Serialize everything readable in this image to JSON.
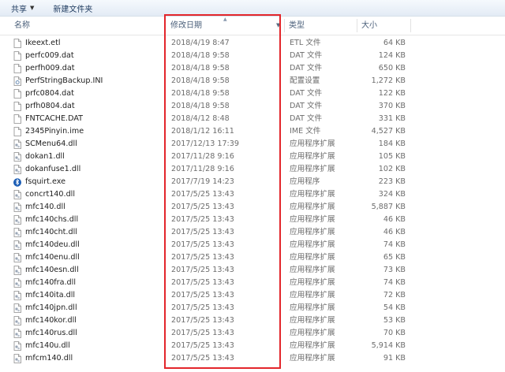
{
  "toolbar": {
    "share_label": "共享",
    "new_folder_label": "新建文件夹"
  },
  "columns": {
    "name": "名称",
    "date": "修改日期",
    "type": "类型",
    "size": "大小"
  },
  "files": [
    {
      "name": "Ikeext.etl",
      "date": "2018/4/19 8:47",
      "type": "ETL 文件",
      "size": "64 KB",
      "icon": "file-icon"
    },
    {
      "name": "perfc009.dat",
      "date": "2018/4/18 9:58",
      "type": "DAT 文件",
      "size": "124 KB",
      "icon": "file-icon"
    },
    {
      "name": "perfh009.dat",
      "date": "2018/4/18 9:58",
      "type": "DAT 文件",
      "size": "650 KB",
      "icon": "file-icon"
    },
    {
      "name": "PerfStringBackup.INI",
      "date": "2018/4/18 9:58",
      "type": "配置设置",
      "size": "1,272 KB",
      "icon": "settings-file-icon"
    },
    {
      "name": "prfc0804.dat",
      "date": "2018/4/18 9:58",
      "type": "DAT 文件",
      "size": "122 KB",
      "icon": "file-icon"
    },
    {
      "name": "prfh0804.dat",
      "date": "2018/4/18 9:58",
      "type": "DAT 文件",
      "size": "370 KB",
      "icon": "file-icon"
    },
    {
      "name": "FNTCACHE.DAT",
      "date": "2018/4/12 8:48",
      "type": "DAT 文件",
      "size": "331 KB",
      "icon": "file-icon"
    },
    {
      "name": "2345Pinyin.ime",
      "date": "2018/1/12 16:11",
      "type": "IME 文件",
      "size": "4,527 KB",
      "icon": "file-icon"
    },
    {
      "name": "SCMenu64.dll",
      "date": "2017/12/13 17:39",
      "type": "应用程序扩展",
      "size": "184 KB",
      "icon": "dll-icon"
    },
    {
      "name": "dokan1.dll",
      "date": "2017/11/28 9:16",
      "type": "应用程序扩展",
      "size": "105 KB",
      "icon": "dll-icon"
    },
    {
      "name": "dokanfuse1.dll",
      "date": "2017/11/28 9:16",
      "type": "应用程序扩展",
      "size": "102 KB",
      "icon": "dll-icon"
    },
    {
      "name": "fsquirt.exe",
      "date": "2017/7/19 14:23",
      "type": "应用程序",
      "size": "223 KB",
      "icon": "bluetooth-exe-icon"
    },
    {
      "name": "concrt140.dll",
      "date": "2017/5/25 13:43",
      "type": "应用程序扩展",
      "size": "324 KB",
      "icon": "dll-icon"
    },
    {
      "name": "mfc140.dll",
      "date": "2017/5/25 13:43",
      "type": "应用程序扩展",
      "size": "5,887 KB",
      "icon": "dll-icon"
    },
    {
      "name": "mfc140chs.dll",
      "date": "2017/5/25 13:43",
      "type": "应用程序扩展",
      "size": "46 KB",
      "icon": "dll-icon"
    },
    {
      "name": "mfc140cht.dll",
      "date": "2017/5/25 13:43",
      "type": "应用程序扩展",
      "size": "46 KB",
      "icon": "dll-icon"
    },
    {
      "name": "mfc140deu.dll",
      "date": "2017/5/25 13:43",
      "type": "应用程序扩展",
      "size": "74 KB",
      "icon": "dll-icon"
    },
    {
      "name": "mfc140enu.dll",
      "date": "2017/5/25 13:43",
      "type": "应用程序扩展",
      "size": "65 KB",
      "icon": "dll-icon"
    },
    {
      "name": "mfc140esn.dll",
      "date": "2017/5/25 13:43",
      "type": "应用程序扩展",
      "size": "73 KB",
      "icon": "dll-icon"
    },
    {
      "name": "mfc140fra.dll",
      "date": "2017/5/25 13:43",
      "type": "应用程序扩展",
      "size": "74 KB",
      "icon": "dll-icon"
    },
    {
      "name": "mfc140ita.dll",
      "date": "2017/5/25 13:43",
      "type": "应用程序扩展",
      "size": "72 KB",
      "icon": "dll-icon"
    },
    {
      "name": "mfc140jpn.dll",
      "date": "2017/5/25 13:43",
      "type": "应用程序扩展",
      "size": "54 KB",
      "icon": "dll-icon"
    },
    {
      "name": "mfc140kor.dll",
      "date": "2017/5/25 13:43",
      "type": "应用程序扩展",
      "size": "53 KB",
      "icon": "dll-icon"
    },
    {
      "name": "mfc140rus.dll",
      "date": "2017/5/25 13:43",
      "type": "应用程序扩展",
      "size": "70 KB",
      "icon": "dll-icon"
    },
    {
      "name": "mfc140u.dll",
      "date": "2017/5/25 13:43",
      "type": "应用程序扩展",
      "size": "5,914 KB",
      "icon": "dll-icon"
    },
    {
      "name": "mfcm140.dll",
      "date": "2017/5/25 13:43",
      "type": "应用程序扩展",
      "size": "91 KB",
      "icon": "dll-icon"
    }
  ],
  "colors": {
    "highlight_box": "#e3262b"
  }
}
